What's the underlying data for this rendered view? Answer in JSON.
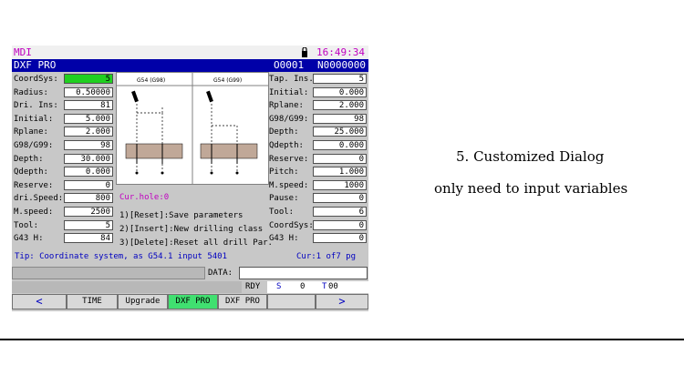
{
  "header": {
    "mode": "MDI",
    "clock": "16:49:34"
  },
  "titlebar": {
    "title": "DXF PRO",
    "program": "O0001",
    "block": "N0000000"
  },
  "left_fields": [
    {
      "label": "CoordSys:",
      "value": "5"
    },
    {
      "label": "Radius:",
      "value": "0.50000"
    },
    {
      "label": "Dri. Ins:",
      "value": "81"
    },
    {
      "label": "Initial:",
      "value": "5.000"
    },
    {
      "label": "Rplane:",
      "value": "2.000"
    },
    {
      "label": "G98/G99:",
      "value": "98"
    },
    {
      "label": "Depth:",
      "value": "30.000"
    },
    {
      "label": "Qdepth:",
      "value": "0.000"
    },
    {
      "label": "Reserve:",
      "value": "0"
    },
    {
      "label": "dri.Speed:",
      "value": "800"
    },
    {
      "label": "M.speed:",
      "value": "2500"
    },
    {
      "label": "Tool:",
      "value": "5"
    },
    {
      "label": "G43 H:",
      "value": "84"
    }
  ],
  "right_fields": [
    {
      "label": "Tap. Ins.:",
      "value": "5"
    },
    {
      "label": "Initial:",
      "value": "0.000"
    },
    {
      "label": "Rplane:",
      "value": "2.000"
    },
    {
      "label": "G98/G99:",
      "value": "98"
    },
    {
      "label": "Depth:",
      "value": "25.000"
    },
    {
      "label": "Qdepth:",
      "value": "0.000"
    },
    {
      "label": "Reserve:",
      "value": "0"
    },
    {
      "label": "Pitch:",
      "value": "1.000"
    },
    {
      "label": "M.speed:",
      "value": "1000"
    },
    {
      "label": "Pause:",
      "value": "0"
    },
    {
      "label": "Tool:",
      "value": "6"
    },
    {
      "label": "CoordSys:",
      "value": "0"
    },
    {
      "label": "G43 H:",
      "value": "0"
    }
  ],
  "diagram": {
    "left_title": "G54 (G98)",
    "right_title": "G54 (G99)"
  },
  "cur_hole": "Cur.hole:0",
  "menu": [
    "1)[Reset]:Save parameters",
    "2)[Insert]:New drilling class",
    "3)[Delete]:Reset all drill Par."
  ],
  "tip": {
    "text": "Tip: Coordinate system, as G54.1 input 5401",
    "page": "Cur:1 of7 pg"
  },
  "data_label": "DATA:",
  "status": {
    "rdy": "RDY",
    "s_label": "S",
    "s_value": "0",
    "t_label": "T",
    "t_value": "00"
  },
  "softkeys": [
    {
      "label": "<"
    },
    {
      "label": "TIME"
    },
    {
      "label": "Upgrade"
    },
    {
      "label": "DXF PRO"
    },
    {
      "label": "DXF PRO"
    },
    {
      "label": ""
    },
    {
      "label": ">"
    }
  ],
  "caption": {
    "line1": "5. Customized Dialog",
    "line2": "only need to input variables"
  },
  "colors": {
    "title_bg": "#0000a8",
    "active_field": "#20d020",
    "active_softkey": "#40e070",
    "mode_text": "#c000c0"
  }
}
